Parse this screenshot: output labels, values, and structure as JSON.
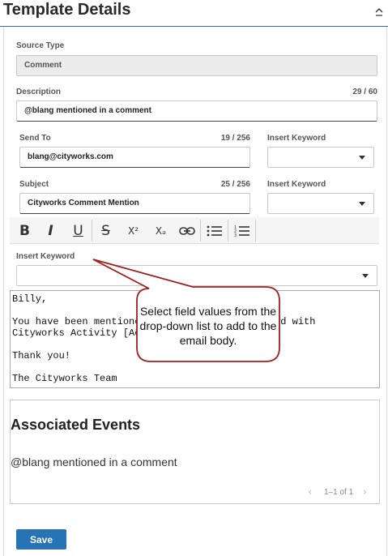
{
  "panel": {
    "title": "Template Details",
    "collapse_icon": "chevron-up-icon"
  },
  "source_type": {
    "label": "Source Type",
    "value": "Comment"
  },
  "description": {
    "label": "Description",
    "counter": "29 / 60",
    "value": "@blang mentioned in a comment"
  },
  "send_to": {
    "label": "Send To",
    "counter": "19 / 256",
    "value": "blang@cityworks.com"
  },
  "send_to_keyword": {
    "label": "Insert Keyword",
    "value": ""
  },
  "subject": {
    "label": "Subject",
    "counter": "25 / 256",
    "value": "Cityworks Comment Mention"
  },
  "subject_keyword": {
    "label": "Insert Keyword",
    "value": ""
  },
  "toolbar": {
    "bold": "B",
    "italic": "I",
    "underline": "U",
    "strike": "S",
    "superscript": "X²",
    "subscript": "Xₔ"
  },
  "body_keyword": {
    "label": "Insert Keyword",
    "value": ""
  },
  "editor": {
    "text": "Billy,\n\nYou have been mentioned in a comment associated with\nCityworks Activity [Activity ID].\n\nThank you!\n\nThe Cityworks Team"
  },
  "callout": {
    "text": "Select field values from the drop-down list to add to the email body."
  },
  "events": {
    "title": "Associated Events",
    "items": [
      "@blang mentioned in a comment"
    ],
    "pager": "1–1 of 1"
  },
  "actions": {
    "save": "Save"
  },
  "colors": {
    "accent": "#2872b6",
    "callout_border": "#a01e1e"
  }
}
